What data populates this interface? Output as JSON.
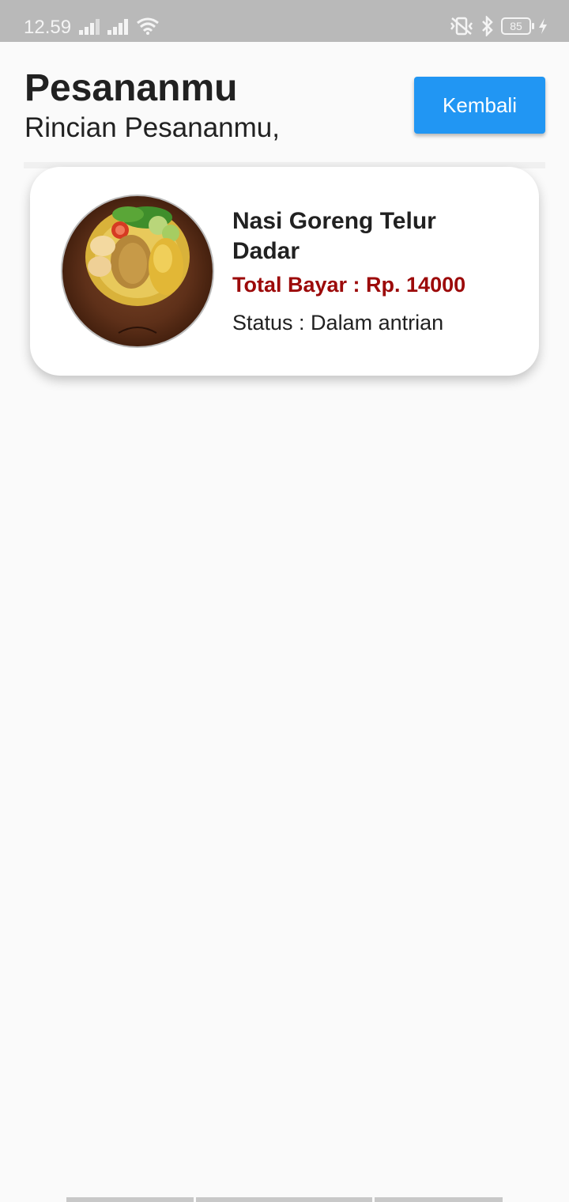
{
  "status_bar": {
    "time": "12.59",
    "battery_level": "85",
    "icons": [
      "signal-icon",
      "signal-icon",
      "wifi-icon",
      "vibrate-off-icon",
      "bluetooth-icon",
      "battery-icon",
      "charging-icon"
    ]
  },
  "header": {
    "title": "Pesananmu",
    "subtitle": "Rincian Pesananmu,",
    "back_label": "Kembali"
  },
  "orders": [
    {
      "name": "Nasi Goreng Telur Dadar",
      "total": "Total Bayar : Rp. 14000",
      "status": "Status : Dalam antrian"
    }
  ],
  "colors": {
    "accent": "#2196f3",
    "price": "#9c0a0a",
    "status_bar": "#b9b9b9",
    "background": "#fafafa"
  }
}
